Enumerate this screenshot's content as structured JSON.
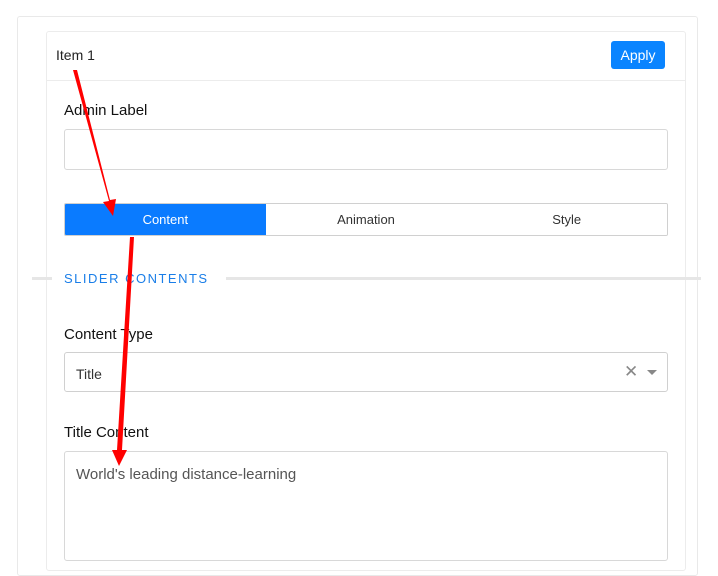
{
  "header": {
    "item_title": "Item 1",
    "apply_label": "Apply"
  },
  "admin_label": {
    "label": "Admin Label",
    "value": ""
  },
  "tabs": [
    {
      "label": "Content",
      "active": true
    },
    {
      "label": "Animation",
      "active": false
    },
    {
      "label": "Style",
      "active": false
    }
  ],
  "section": {
    "title": "SLIDER CONTENTS"
  },
  "content_type": {
    "label": "Content Type",
    "selected": "Title"
  },
  "title_content": {
    "label": "Title Content",
    "value": "World's leading distance-learning"
  },
  "colors": {
    "accent": "#0a7bff",
    "annotation_arrow": "#ff0000",
    "section_title": "#1a7ee8"
  },
  "icons": {
    "clear": "close-icon",
    "dropdown": "caret-down-icon"
  }
}
